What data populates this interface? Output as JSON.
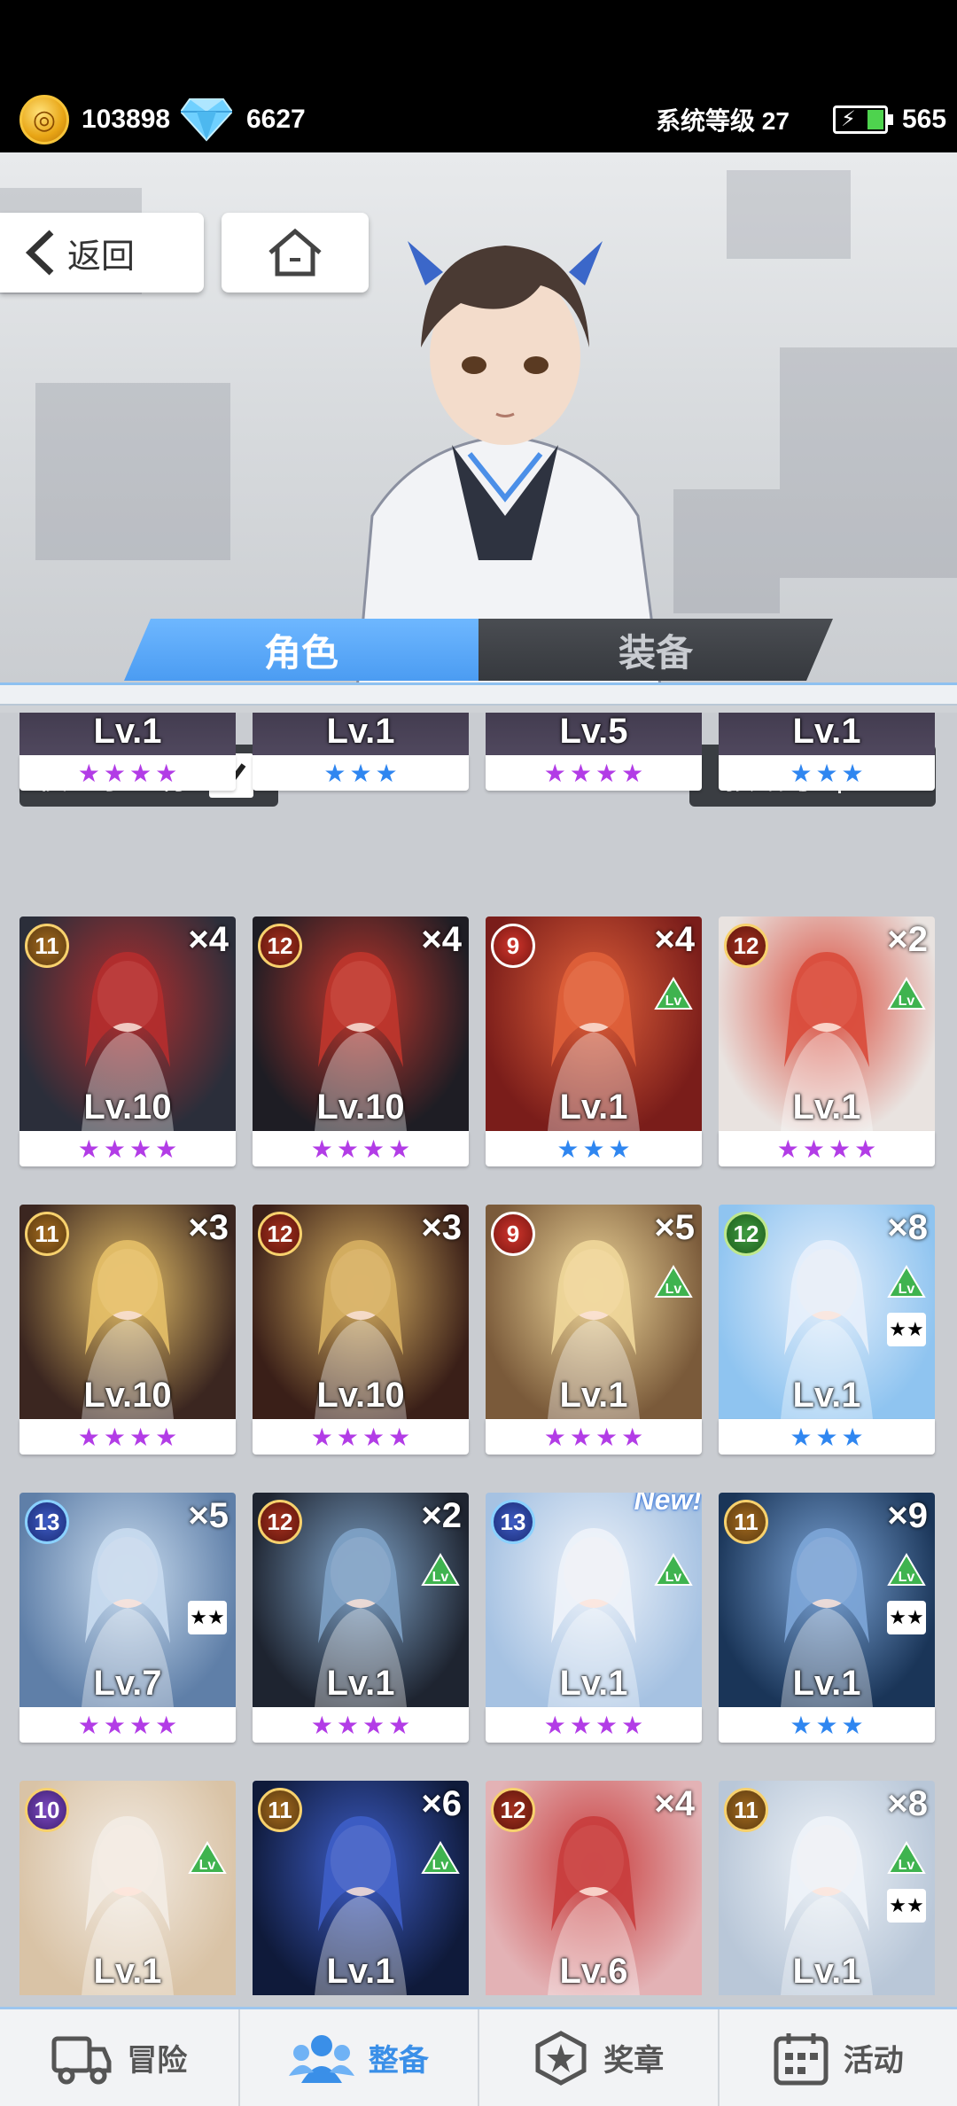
{
  "status": {
    "gold": "103898",
    "gems": "6627",
    "system_level": "系统等级 27",
    "stamina": "565"
  },
  "header": {
    "back_label": "返回"
  },
  "tabs": [
    {
      "label": "角色",
      "active": true
    },
    {
      "label": "装备",
      "active": false
    }
  ],
  "filter": {
    "owned_only_label": "仅显示已有",
    "owned_only_checked": true,
    "sort_label": "按编号"
  },
  "partial_row": [
    {
      "level": "Lv.1",
      "stars": 4
    },
    {
      "level": "Lv.1",
      "stars": 3
    },
    {
      "level": "Lv.5",
      "stars": 4
    },
    {
      "level": "Lv.1",
      "stars": 3
    }
  ],
  "cards": [
    {
      "cost": "11",
      "count": "×4",
      "level": "Lv.10",
      "stars": 4,
      "lvup": false,
      "star_badge": false,
      "new": false
    },
    {
      "cost": "12",
      "count": "×4",
      "level": "Lv.10",
      "stars": 4,
      "lvup": false,
      "star_badge": false,
      "new": false
    },
    {
      "cost": "9",
      "count": "×4",
      "level": "Lv.1",
      "stars": 3,
      "lvup": true,
      "star_badge": false,
      "new": false
    },
    {
      "cost": "12",
      "count": "×2",
      "level": "Lv.1",
      "stars": 4,
      "lvup": true,
      "star_badge": false,
      "new": false
    },
    {
      "cost": "11",
      "count": "×3",
      "level": "Lv.10",
      "stars": 4,
      "lvup": false,
      "star_badge": false,
      "new": false
    },
    {
      "cost": "12",
      "count": "×3",
      "level": "Lv.10",
      "stars": 4,
      "lvup": false,
      "star_badge": false,
      "new": false
    },
    {
      "cost": "9",
      "count": "×5",
      "level": "Lv.1",
      "stars": 4,
      "lvup": true,
      "star_badge": false,
      "new": false
    },
    {
      "cost": "12",
      "count": "×8",
      "level": "Lv.1",
      "stars": 3,
      "lvup": true,
      "star_badge": true,
      "new": false
    },
    {
      "cost": "13",
      "count": "×5",
      "level": "Lv.7",
      "stars": 4,
      "lvup": false,
      "star_badge": true,
      "new": false
    },
    {
      "cost": "12",
      "count": "×2",
      "level": "Lv.1",
      "stars": 4,
      "lvup": true,
      "star_badge": false,
      "new": false
    },
    {
      "cost": "13",
      "count": "",
      "level": "Lv.1",
      "stars": 4,
      "lvup": true,
      "star_badge": false,
      "new": true,
      "new_label": "New!"
    },
    {
      "cost": "11",
      "count": "×9",
      "level": "Lv.1",
      "stars": 3,
      "lvup": true,
      "star_badge": true,
      "new": false
    },
    {
      "cost": "10",
      "count": "",
      "level": "Lv.1",
      "stars": 0,
      "lvup": true,
      "star_badge": false,
      "new": false
    },
    {
      "cost": "11",
      "count": "×6",
      "level": "Lv.1",
      "stars": 0,
      "lvup": true,
      "star_badge": false,
      "new": false
    },
    {
      "cost": "12",
      "count": "×4",
      "level": "Lv.6",
      "stars": 0,
      "lvup": false,
      "star_badge": false,
      "new": false
    },
    {
      "cost": "11",
      "count": "×8",
      "level": "Lv.1",
      "stars": 0,
      "lvup": true,
      "star_badge": true,
      "new": false
    }
  ],
  "nav": [
    {
      "label": "冒险",
      "icon": "truck-icon",
      "active": false
    },
    {
      "label": "整备",
      "icon": "team-icon",
      "active": true
    },
    {
      "label": "奖章",
      "icon": "medal-icon",
      "active": false
    },
    {
      "label": "活动",
      "icon": "calendar-icon",
      "active": false
    }
  ],
  "colors": {
    "accent": "#3a8fe8",
    "star_purple": "#b23ce6",
    "star_blue": "#2f86f0",
    "panel_dark": "#3a3d42"
  }
}
